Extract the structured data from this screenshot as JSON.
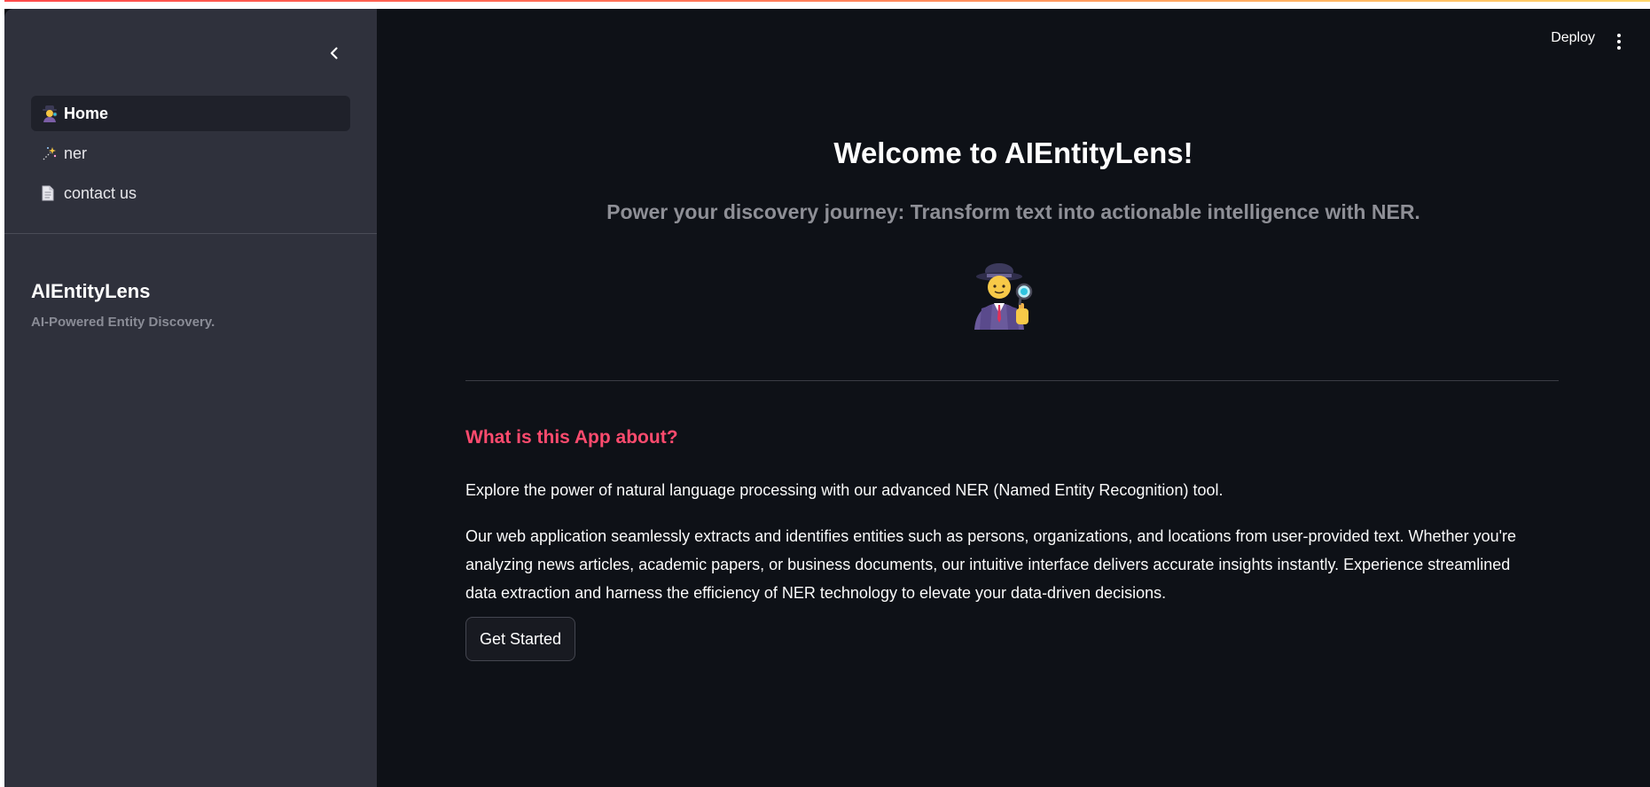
{
  "sidebar": {
    "items": [
      {
        "label": "Home",
        "icon": "detective-icon",
        "active": true
      },
      {
        "label": "ner",
        "icon": "sparkles-icon",
        "active": false
      },
      {
        "label": "contact us",
        "icon": "document-icon",
        "active": false
      }
    ],
    "brand_title": "AIEntityLens",
    "brand_subtitle": "AI-Powered Entity Discovery."
  },
  "header": {
    "deploy_label": "Deploy"
  },
  "main": {
    "title": "Welcome to AIEntityLens!",
    "tagline": "Power your discovery journey: Transform text into actionable intelligence with NER.",
    "hero_icon": "detective-icon",
    "section_title": "What is this App about?",
    "paragraph1": "Explore the power of natural language processing with our advanced NER (Named Entity Recognition) tool.",
    "paragraph2": "Our web application seamlessly extracts and identifies entities such as persons, organizations, and locations from user-provided text. Whether you're analyzing news articles, academic papers, or business documents, our intuitive interface delivers accurate insights instantly. Experience streamlined data extraction and harness the efficiency of NER technology to elevate your data-driven decisions.",
    "cta_label": "Get Started"
  },
  "colors": {
    "accent": "#ff4b6e",
    "background": "#0e1117",
    "sidebar": "#2f313c"
  }
}
